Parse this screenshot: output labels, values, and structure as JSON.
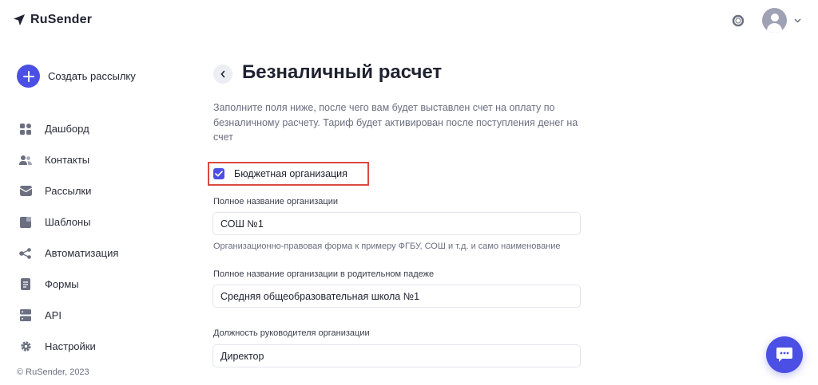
{
  "brand": {
    "name": "RuSender"
  },
  "header": {
    "help_icon": "lifebuoy-icon",
    "avatar_icon": "user-icon",
    "menu_icon": "chevron-down-icon"
  },
  "sidebar": {
    "create_label": "Создать рассылку",
    "items": [
      {
        "label": "Дашборд",
        "icon": "dashboard-icon"
      },
      {
        "label": "Контакты",
        "icon": "contacts-icon"
      },
      {
        "label": "Рассылки",
        "icon": "mail-icon"
      },
      {
        "label": "Шаблоны",
        "icon": "templates-icon"
      },
      {
        "label": "Автоматизация",
        "icon": "automation-icon"
      },
      {
        "label": "Формы",
        "icon": "forms-icon"
      },
      {
        "label": "API",
        "icon": "api-icon"
      },
      {
        "label": "Настройки",
        "icon": "gear-icon"
      }
    ],
    "copyright": "© RuSender, 2023"
  },
  "main": {
    "title": "Безналичный расчет",
    "intro": "Заполните поля ниже, после чего вам будет выставлен счет на оплату по безналичному расчету. Тариф будет активирован после поступления денег на счет",
    "budget_checkbox": {
      "label": "Бюджетная организация",
      "checked": true
    },
    "fields": [
      {
        "label": "Полное название организации",
        "value": "СОШ №1",
        "hint": "Организационно-правовая форма к примеру ФГБУ, СОШ и т.д. и само наименование"
      },
      {
        "label": "Полное название организации в родительном падеже",
        "value": "Средняя общеобразовательная школа №1"
      },
      {
        "label": "Должность руководителя организации",
        "value": "Директор"
      }
    ]
  },
  "colors": {
    "accent": "#4b4fe4",
    "highlight_border": "#d94a3f",
    "muted_text": "#6b6f80"
  }
}
